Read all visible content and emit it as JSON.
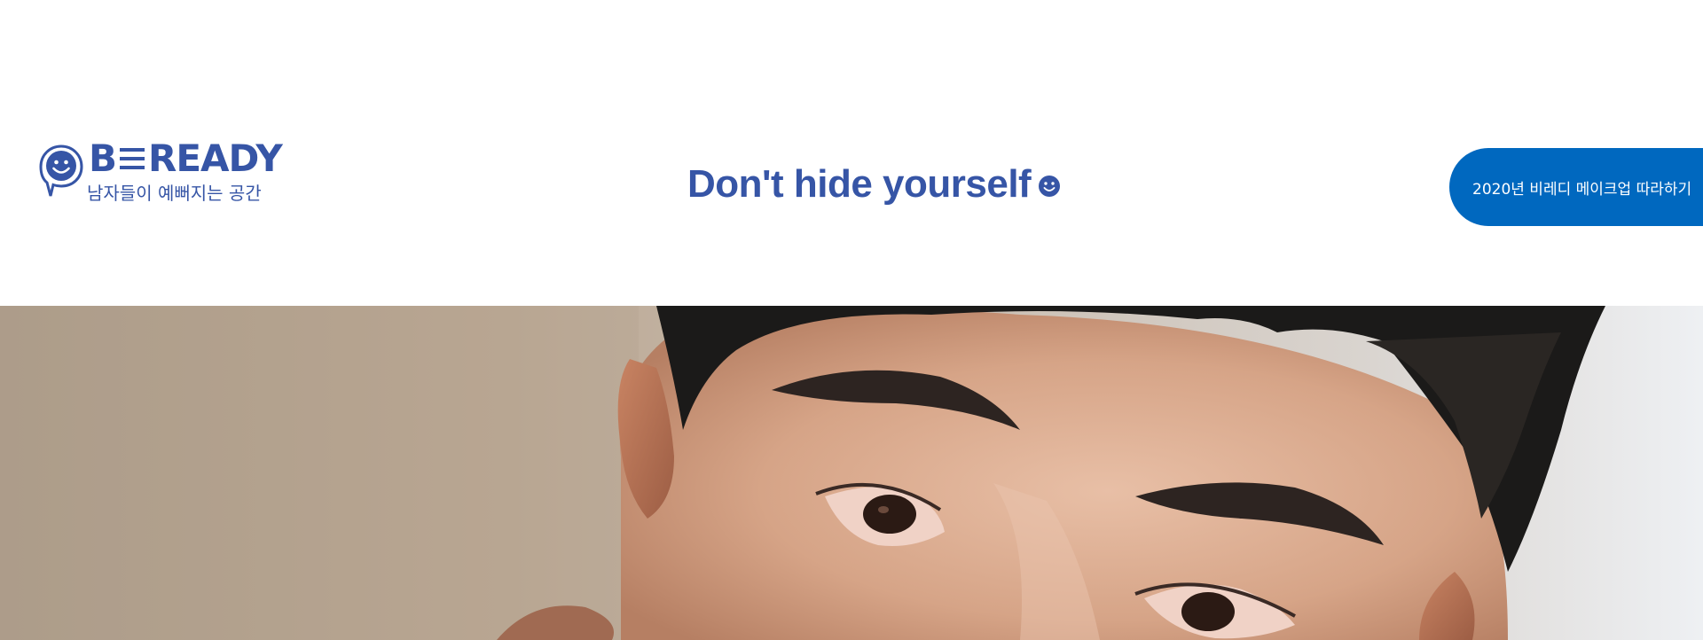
{
  "header": {
    "logo": {
      "wordmark_start": "B",
      "wordmark_end": "READY",
      "tagline": "남자들이 예뻐지는 공간",
      "icon": "smile-speech-bubble-icon"
    },
    "headline": {
      "text": "Don't hide yourself",
      "icon": "smile-icon"
    },
    "cta": {
      "label": "2020년 비레디 메이크업 따라하기"
    }
  },
  "hero": {
    "image": "close-up-portrait-photo"
  },
  "colors": {
    "brand": "#3655a6",
    "cta_bg": "#0068bf",
    "background": "#ffffff"
  }
}
